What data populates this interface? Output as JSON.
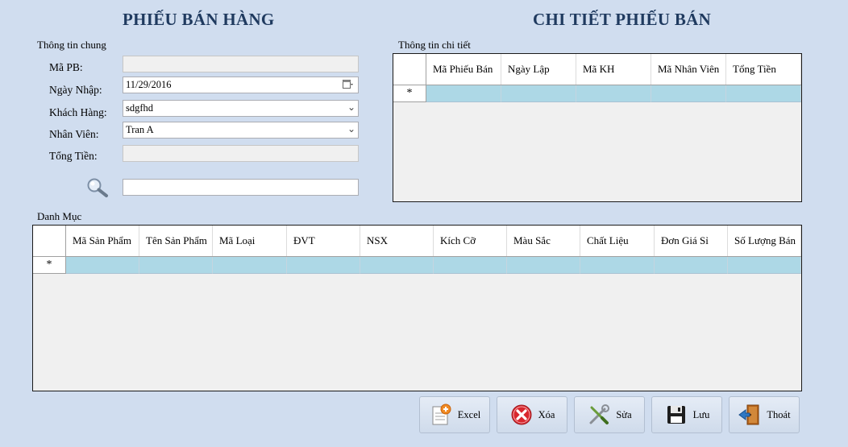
{
  "left_title": "PHIẾU BÁN HÀNG",
  "right_title": "CHI TIẾT PHIẾU BÁN",
  "general_info": {
    "group_label": "Thông tin chung",
    "ma_pb_label": "Mã PB:",
    "ma_pb_value": "",
    "ngay_nhap_label": "Ngày Nhập:",
    "ngay_nhap_value": "11/29/2016",
    "khach_hang_label": "Khách Hàng:",
    "khach_hang_value": "sdgfhd",
    "nhan_vien_label": "Nhân Viên:",
    "nhan_vien_value": "Tran A",
    "tong_tien_label": "Tổng Tiền:",
    "tong_tien_value": "",
    "search_value": ""
  },
  "detail_info": {
    "group_label": "Thông tin chi tiết",
    "columns": [
      "Mã Phiếu Bán",
      "Ngày Lập",
      "Mã KH",
      "Mã Nhân Viên",
      "Tổng Tiền"
    ],
    "new_row_marker": "*"
  },
  "catalog": {
    "group_label": "Danh Mục",
    "columns": [
      "Mã Sản Phẩm",
      "Tên Sản Phẩm",
      "Mã Loại",
      "ĐVT",
      "NSX",
      "Kích Cỡ",
      "Màu Sắc",
      "Chất Liệu",
      "Đơn Giá Sỉ",
      "Số Lượng Bán"
    ],
    "new_row_marker": "*"
  },
  "buttons": {
    "excel": "Excel",
    "delete": "Xóa",
    "edit": "Sửa",
    "save": "Lưu",
    "exit": "Thoát"
  },
  "icons": {
    "search": "magnifier-icon",
    "excel": "document-add-icon",
    "delete": "red-x-icon",
    "edit": "tools-icon",
    "save": "floppy-disk-icon",
    "exit": "exit-door-icon"
  },
  "colors": {
    "background": "#d0ddef",
    "title": "#1f3a5f",
    "new_row": "#add8e6"
  }
}
